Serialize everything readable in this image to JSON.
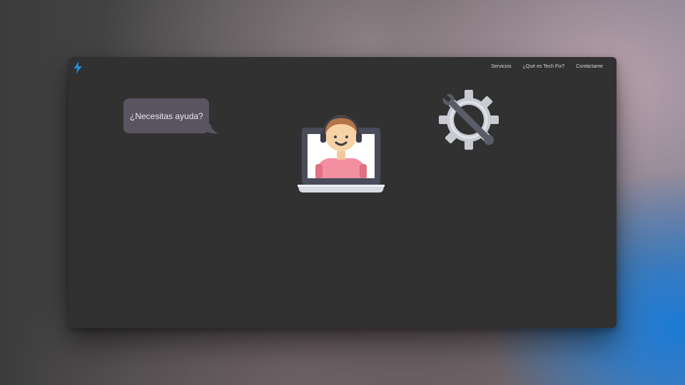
{
  "nav": {
    "items": [
      {
        "label": "Servicios"
      },
      {
        "label": "¿Qué es Tech Fix?"
      },
      {
        "label": "Contáctame"
      }
    ]
  },
  "hero": {
    "bubble_text": "¿Necesitas ayuda?"
  },
  "icons": {
    "logo": "lightning-bolt-icon",
    "illustration": "support-agent-laptop-icon",
    "tools": "gear-wrench-icon"
  },
  "colors": {
    "accent": "#1e8fe0",
    "window_bg": "#313131",
    "bubble_bg": "#5a5462"
  }
}
